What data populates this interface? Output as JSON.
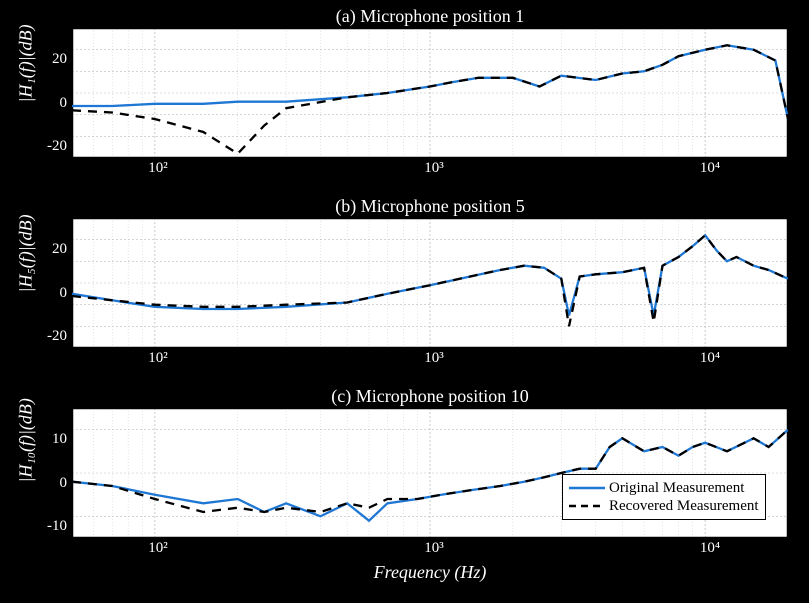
{
  "titles": {
    "p1": "(a) Microphone position 1",
    "p2": "(b) Microphone position 5",
    "p3": "(c) Microphone position 10"
  },
  "axis_labels": {
    "y1": "|H₁(f)|(dB)",
    "y2": "|H₅(f)|(dB)",
    "y3": "|H₁₀(f)|(dB)",
    "x": "Frequency (Hz)"
  },
  "legend": {
    "s1": "Original Measurement",
    "s2": "Recovered Measurement"
  },
  "yticks": {
    "p1": [
      "-20",
      "0",
      "20"
    ],
    "p2": [
      "-20",
      "0",
      "20"
    ],
    "p3": [
      "-10",
      "0",
      "10"
    ]
  },
  "xticks": [
    "10²",
    "10³",
    "10⁴"
  ],
  "chart_data": {
    "xaxis": {
      "scale": "log",
      "range_hz": [
        50,
        20000
      ],
      "ticks_hz": [
        100,
        1000,
        10000
      ]
    },
    "panels": [
      {
        "title": "Microphone position 1",
        "ylabel": "|H1(f)| (dB)",
        "ylim": [
          -30,
          30
        ],
        "series": [
          {
            "name": "Original Measurement",
            "color": "#1f77d4",
            "style": "solid",
            "freq_hz": [
              50,
              70,
              100,
              150,
              200,
              300,
              500,
              700,
              1000,
              1200,
              1500,
              2000,
              2500,
              3000,
              4000,
              5000,
              6000,
              7000,
              8000,
              10000,
              12000,
              15000,
              18000,
              20000
            ],
            "mag_db": [
              -6,
              -6,
              -5,
              -5,
              -4,
              -4,
              -2,
              0,
              3,
              5,
              7,
              7,
              3,
              8,
              6,
              9,
              10,
              13,
              17,
              20,
              22,
              20,
              15,
              -12
            ]
          },
          {
            "name": "Recovered Measurement",
            "color": "#000000",
            "style": "dashed",
            "freq_hz": [
              50,
              70,
              100,
              150,
              200,
              250,
              300,
              500,
              700,
              1000,
              1200,
              1500,
              2000,
              2500,
              3000,
              4000,
              5000,
              6000,
              7000,
              8000,
              10000,
              12000,
              15000,
              18000,
              20000
            ],
            "mag_db": [
              -8,
              -9,
              -12,
              -18,
              -28,
              -15,
              -7,
              -2,
              0,
              3,
              5,
              7,
              7,
              3,
              8,
              6,
              9,
              10,
              13,
              17,
              20,
              22,
              20,
              15,
              -12
            ]
          }
        ]
      },
      {
        "title": "Microphone position 5",
        "ylabel": "|H5(f)| (dB)",
        "ylim": [
          -30,
          30
        ],
        "series": [
          {
            "name": "Original Measurement",
            "color": "#1f77d4",
            "style": "solid",
            "freq_hz": [
              50,
              70,
              100,
              150,
              200,
              300,
              500,
              700,
              1000,
              1400,
              1800,
              2200,
              2600,
              3000,
              3200,
              3500,
              4000,
              5000,
              6000,
              6500,
              7000,
              8000,
              9000,
              10000,
              11000,
              12000,
              13000,
              15000,
              17000,
              20000
            ],
            "mag_db": [
              -5,
              -8,
              -11,
              -12,
              -12,
              -11,
              -9,
              -5,
              -1,
              3,
              6,
              8,
              7,
              2,
              -15,
              3,
              4,
              5,
              7,
              -15,
              8,
              12,
              17,
              22,
              15,
              10,
              12,
              8,
              6,
              2
            ]
          },
          {
            "name": "Recovered Measurement",
            "color": "#000000",
            "style": "dashed",
            "freq_hz": [
              50,
              70,
              100,
              150,
              200,
              300,
              500,
              700,
              1000,
              1400,
              1800,
              2200,
              2600,
              3000,
              3200,
              3500,
              4000,
              5000,
              6000,
              6500,
              7000,
              8000,
              9000,
              10000,
              11000,
              12000,
              13000,
              15000,
              17000,
              20000
            ],
            "mag_db": [
              -6,
              -8,
              -10,
              -11,
              -11,
              -10,
              -9,
              -5,
              -1,
              3,
              6,
              8,
              7,
              2,
              -20,
              3,
              4,
              5,
              7,
              -18,
              8,
              12,
              17,
              22,
              15,
              10,
              12,
              8,
              6,
              2
            ]
          }
        ]
      },
      {
        "title": "Microphone position 10",
        "ylabel": "|H10(f)| (dB)",
        "ylim": [
          -15,
          15
        ],
        "series": [
          {
            "name": "Original Measurement",
            "color": "#1f77d4",
            "style": "solid",
            "freq_hz": [
              50,
              70,
              100,
              150,
              200,
              250,
              300,
              400,
              500,
              600,
              700,
              900,
              1100,
              1400,
              1800,
              2200,
              2600,
              3000,
              3500,
              4000,
              4500,
              5000,
              6000,
              7000,
              8000,
              9000,
              10000,
              12000,
              15000,
              17000,
              20000
            ],
            "mag_db": [
              -2,
              -3,
              -5,
              -7,
              -6,
              -9,
              -7,
              -10,
              -7,
              -11,
              -7,
              -6,
              -5,
              -4,
              -3,
              -2,
              -1,
              0,
              1,
              1,
              6,
              8,
              5,
              6,
              4,
              6,
              7,
              5,
              8,
              6,
              10
            ]
          },
          {
            "name": "Recovered Measurement",
            "color": "#000000",
            "style": "dashed",
            "freq_hz": [
              50,
              70,
              100,
              150,
              200,
              250,
              300,
              400,
              500,
              600,
              700,
              900,
              1100,
              1400,
              1800,
              2200,
              2600,
              3000,
              3500,
              4000,
              4500,
              5000,
              6000,
              7000,
              8000,
              9000,
              10000,
              12000,
              15000,
              17000,
              20000
            ],
            "mag_db": [
              -2,
              -3,
              -6,
              -9,
              -8,
              -9,
              -8,
              -9,
              -7,
              -8,
              -6,
              -6,
              -5,
              -4,
              -3,
              -2,
              -1,
              0,
              1,
              1,
              6,
              8,
              5,
              6,
              4,
              6,
              7,
              5,
              8,
              6,
              10
            ]
          }
        ]
      }
    ]
  }
}
